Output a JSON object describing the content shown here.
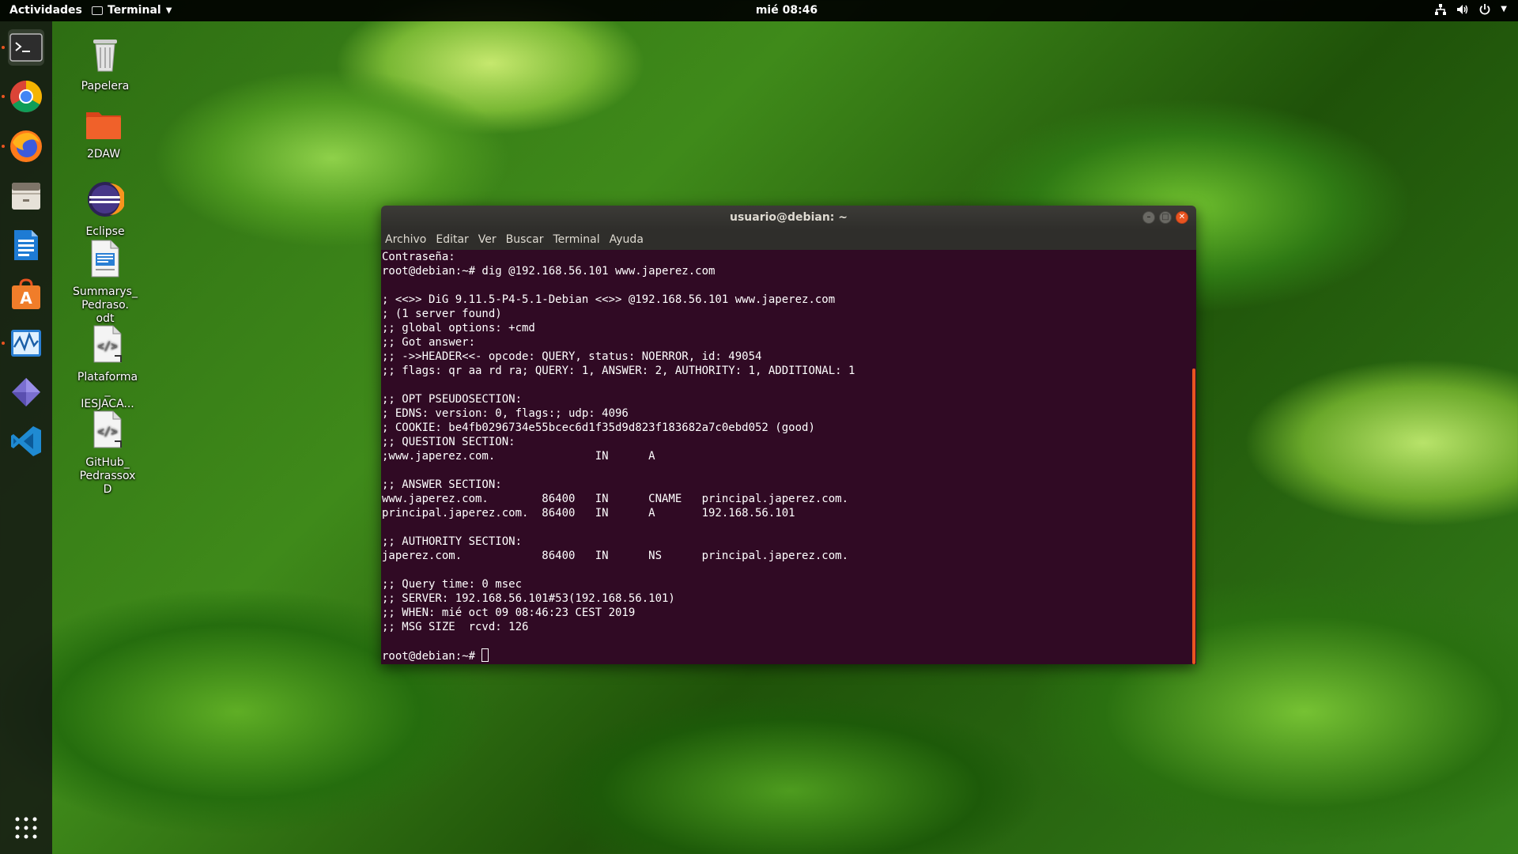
{
  "top_bar": {
    "activities": "Actividades",
    "app_name": "Terminal",
    "clock": "mié 08:46"
  },
  "desktop_icons": [
    {
      "label": "Papelera"
    },
    {
      "label": "2DAW"
    },
    {
      "label": "Eclipse"
    },
    {
      "label": "Summarys_\nPedraso.\nodt"
    },
    {
      "label": "Plataforma\n_\nIESJACA..."
    },
    {
      "label": "GitHub_\nPedrassox\nD"
    }
  ],
  "terminal": {
    "title": "usuario@debian: ~",
    "menu": [
      "Archivo",
      "Editar",
      "Ver",
      "Buscar",
      "Terminal",
      "Ayuda"
    ],
    "lines": [
      "Contraseña:",
      "root@debian:~# dig @192.168.56.101 www.japerez.com",
      "",
      "; <<>> DiG 9.11.5-P4-5.1-Debian <<>> @192.168.56.101 www.japerez.com",
      "; (1 server found)",
      ";; global options: +cmd",
      ";; Got answer:",
      ";; ->>HEADER<<- opcode: QUERY, status: NOERROR, id: 49054",
      ";; flags: qr aa rd ra; QUERY: 1, ANSWER: 2, AUTHORITY: 1, ADDITIONAL: 1",
      "",
      ";; OPT PSEUDOSECTION:",
      "; EDNS: version: 0, flags:; udp: 4096",
      "; COOKIE: be4fb0296734e55bcec6d1f35d9d823f183682a7c0ebd052 (good)",
      ";; QUESTION SECTION:",
      ";www.japerez.com.               IN      A",
      "",
      ";; ANSWER SECTION:",
      "www.japerez.com.        86400   IN      CNAME   principal.japerez.com.",
      "principal.japerez.com.  86400   IN      A       192.168.56.101",
      "",
      ";; AUTHORITY SECTION:",
      "japerez.com.            86400   IN      NS      principal.japerez.com.",
      "",
      ";; Query time: 0 msec",
      ";; SERVER: 192.168.56.101#53(192.168.56.101)",
      ";; WHEN: mié oct 09 08:46:23 CEST 2019",
      ";; MSG SIZE  rcvd: 126",
      ""
    ],
    "prompt": "root@debian:~# "
  },
  "colors": {
    "terminal_bg": "#300a24",
    "accent": "#e95420"
  }
}
